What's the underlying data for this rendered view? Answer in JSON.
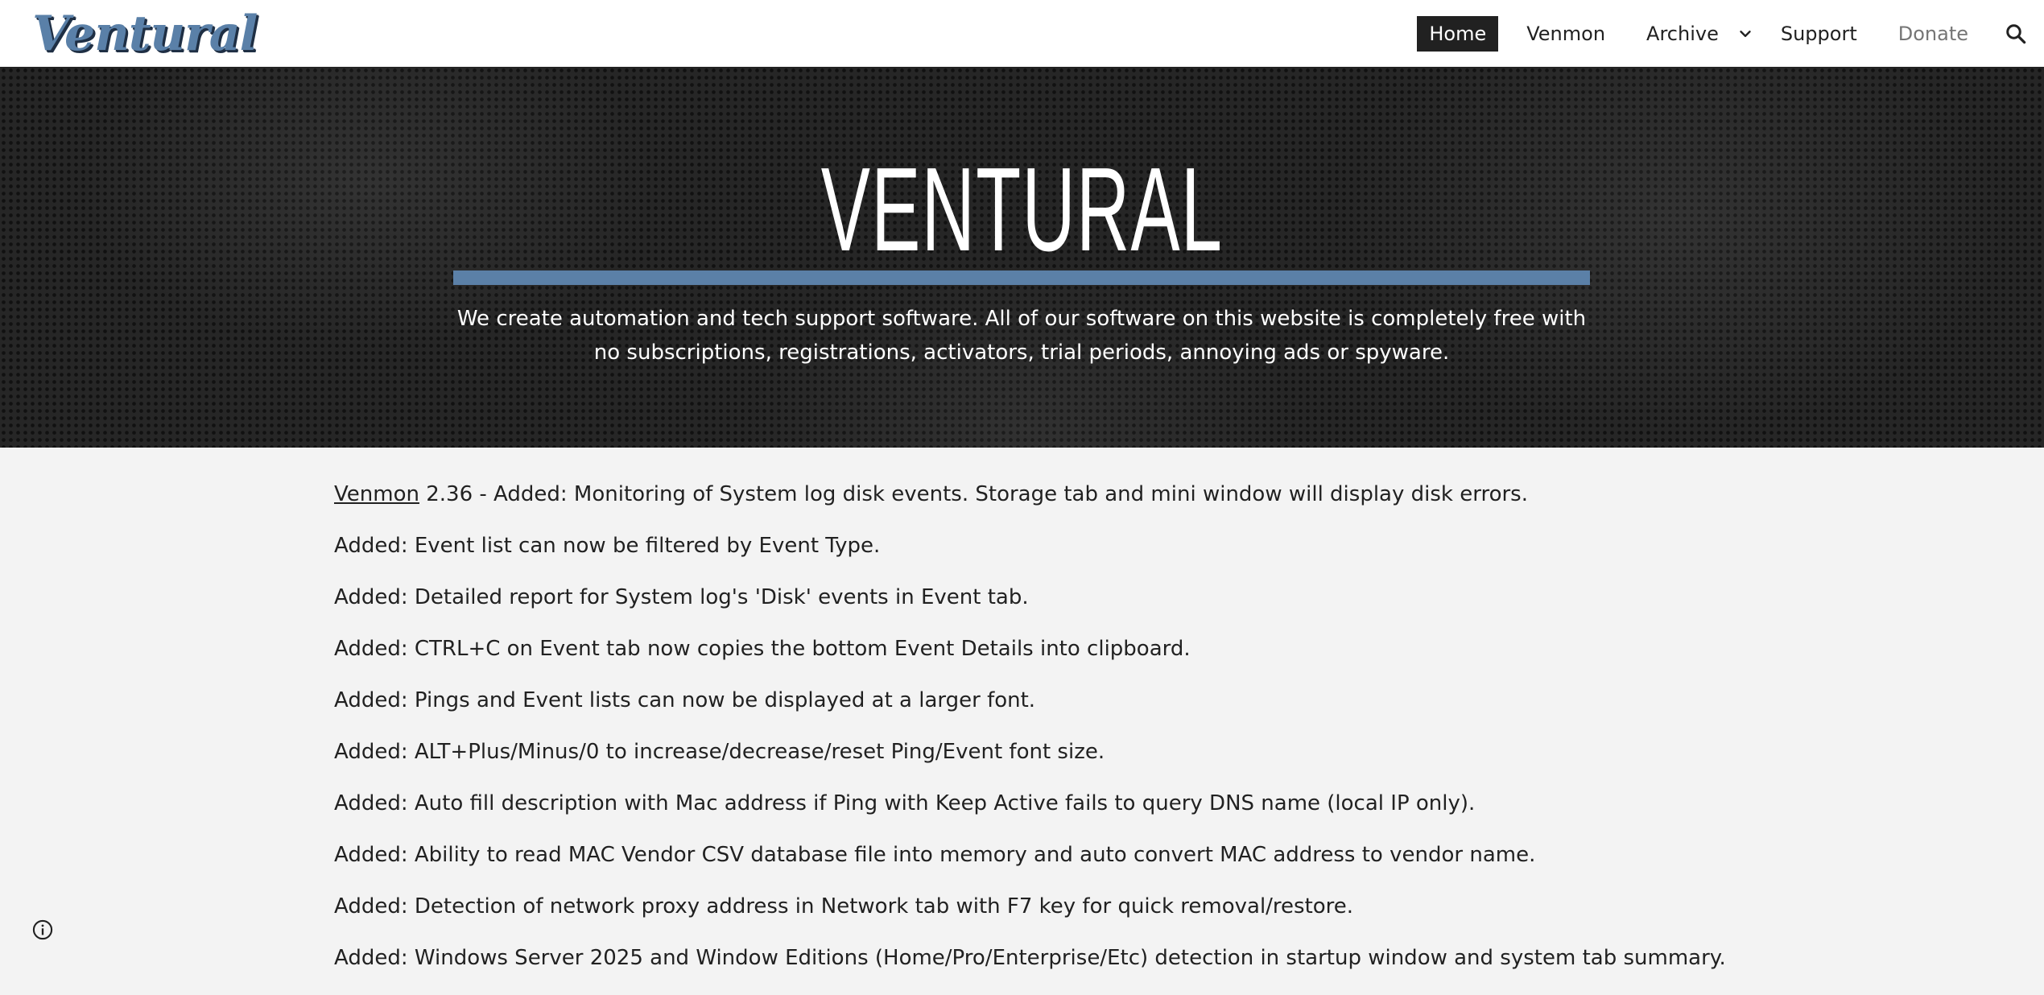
{
  "header": {
    "logo_text": "Ventural",
    "nav": {
      "home": "Home",
      "venmon": "Venmon",
      "archive": "Archive",
      "support": "Support",
      "donate": "Donate"
    },
    "icons": {
      "archive_dropdown": "chevron-down-icon",
      "search": "search-icon"
    }
  },
  "hero": {
    "title": "VENTURAL",
    "subtitle": "We create automation and tech support software. All of our software on this website is completely free with no subscriptions, registrations, activators, trial periods, annoying ads or spyware."
  },
  "content": {
    "intro_link": "Venmon",
    "intro_rest": " 2.36 - Added: Monitoring of System log disk events. Storage tab and mini window will display disk errors.",
    "lines": [
      "Added: Event list can now be filtered by Event Type.",
      "Added: Detailed report for System log's 'Disk' events in Event tab.",
      "Added: CTRL+C on Event tab now copies the bottom Event Details into clipboard.",
      "Added: Pings and Event lists can now be displayed at a larger font.",
      "Added: ALT+Plus/Minus/0 to increase/decrease/reset Ping/Event font size.",
      "Added: Auto fill description with Mac address if Ping with Keep Active fails to query DNS name (local IP only).",
      "Added: Ability to read MAC Vendor CSV database file into memory and auto convert MAC address to vendor name.",
      "Added: Detection of network proxy address in Network tab with F7 key for quick removal/restore.",
      "Added: Windows Server 2025 and Window Editions (Home/Pro/Enterprise/Etc) detection in startup window and system tab summary."
    ]
  },
  "footer": {
    "info_icon": "info-icon"
  },
  "colors": {
    "accent": "#5b80a7",
    "nav_active_bg": "#212121",
    "hero_bg": "#262626",
    "page_bg": "#f3f3f3"
  }
}
